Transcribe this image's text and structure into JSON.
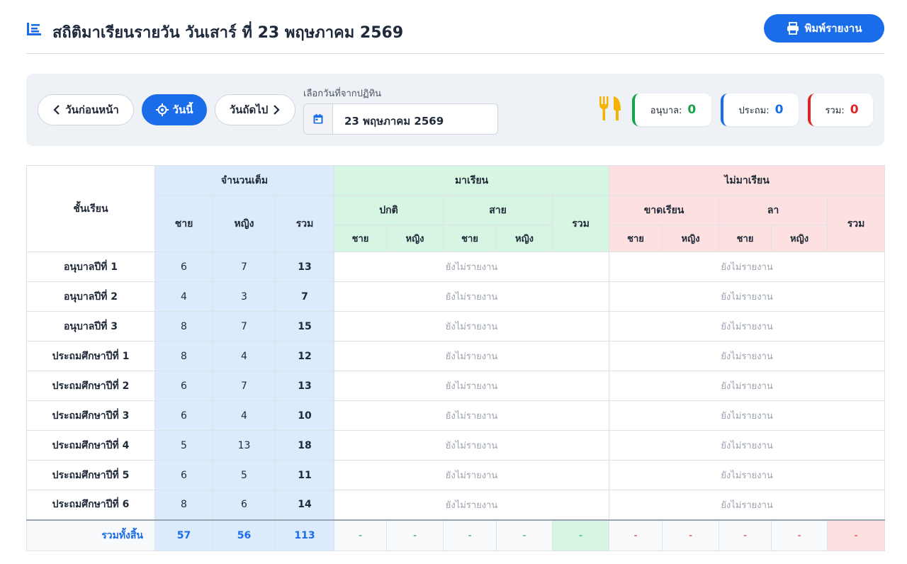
{
  "header": {
    "title": "สถิติมาเรียนรายวัน วันเสาร์ ที่ 23 พฤษภาคม 2569",
    "print_label": "พิมพ์รายงาน"
  },
  "toolbar": {
    "prev_label": "วันก่อนหน้า",
    "today_label": "วันนี้",
    "next_label": "วันถัดไป",
    "date_picker_label": "เลือกวันที่จากปฏิทิน",
    "date_value": "23 พฤษภาคม 2569",
    "stats": {
      "kindergarten_label": "อนุบาล:",
      "kindergarten_value": "0",
      "primary_label": "ประถม:",
      "primary_value": "0",
      "total_label": "รวม:",
      "total_value": "0"
    }
  },
  "colors": {
    "accent": "#1a6ce8",
    "green": "#16a34a",
    "red": "#dc2626",
    "meal_icon": "#f5b301"
  },
  "table": {
    "grade_header": "ชั้นเรียน",
    "full_header": "จำนวนเต็ม",
    "present_header": "มาเรียน",
    "absent_header": "ไม่มาเรียน",
    "normal_header": "ปกติ",
    "late_header": "สาย",
    "missed_header": "ขาดเรียน",
    "leave_header": "ลา",
    "male": "ชาย",
    "female": "หญิง",
    "sum": "รวม",
    "rows": [
      {
        "grade": "อนุบาลปีที่ 1",
        "male": "6",
        "female": "7",
        "total": "13",
        "present": "ยังไม่รายงาน",
        "absent": "ยังไม่รายงาน"
      },
      {
        "grade": "อนุบาลปีที่ 2",
        "male": "4",
        "female": "3",
        "total": "7",
        "present": "ยังไม่รายงาน",
        "absent": "ยังไม่รายงาน"
      },
      {
        "grade": "อนุบาลปีที่ 3",
        "male": "8",
        "female": "7",
        "total": "15",
        "present": "ยังไม่รายงาน",
        "absent": "ยังไม่รายงาน"
      },
      {
        "grade": "ประถมศึกษาปีที่ 1",
        "male": "8",
        "female": "4",
        "total": "12",
        "present": "ยังไม่รายงาน",
        "absent": "ยังไม่รายงาน"
      },
      {
        "grade": "ประถมศึกษาปีที่ 2",
        "male": "6",
        "female": "7",
        "total": "13",
        "present": "ยังไม่รายงาน",
        "absent": "ยังไม่รายงาน"
      },
      {
        "grade": "ประถมศึกษาปีที่ 3",
        "male": "6",
        "female": "4",
        "total": "10",
        "present": "ยังไม่รายงาน",
        "absent": "ยังไม่รายงาน"
      },
      {
        "grade": "ประถมศึกษาปีที่ 4",
        "male": "5",
        "female": "13",
        "total": "18",
        "present": "ยังไม่รายงาน",
        "absent": "ยังไม่รายงาน"
      },
      {
        "grade": "ประถมศึกษาปีที่ 5",
        "male": "6",
        "female": "5",
        "total": "11",
        "present": "ยังไม่รายงาน",
        "absent": "ยังไม่รายงาน"
      },
      {
        "grade": "ประถมศึกษาปีที่ 6",
        "male": "8",
        "female": "6",
        "total": "14",
        "present": "ยังไม่รายงาน",
        "absent": "ยังไม่รายงาน"
      }
    ],
    "total_row": {
      "label": "รวมทั้งสิ้น",
      "male": "57",
      "female": "56",
      "total": "113",
      "present_cells": [
        "-",
        "-",
        "-",
        "-",
        "-"
      ],
      "absent_cells": [
        "-",
        "-",
        "-",
        "-",
        "-"
      ]
    }
  }
}
